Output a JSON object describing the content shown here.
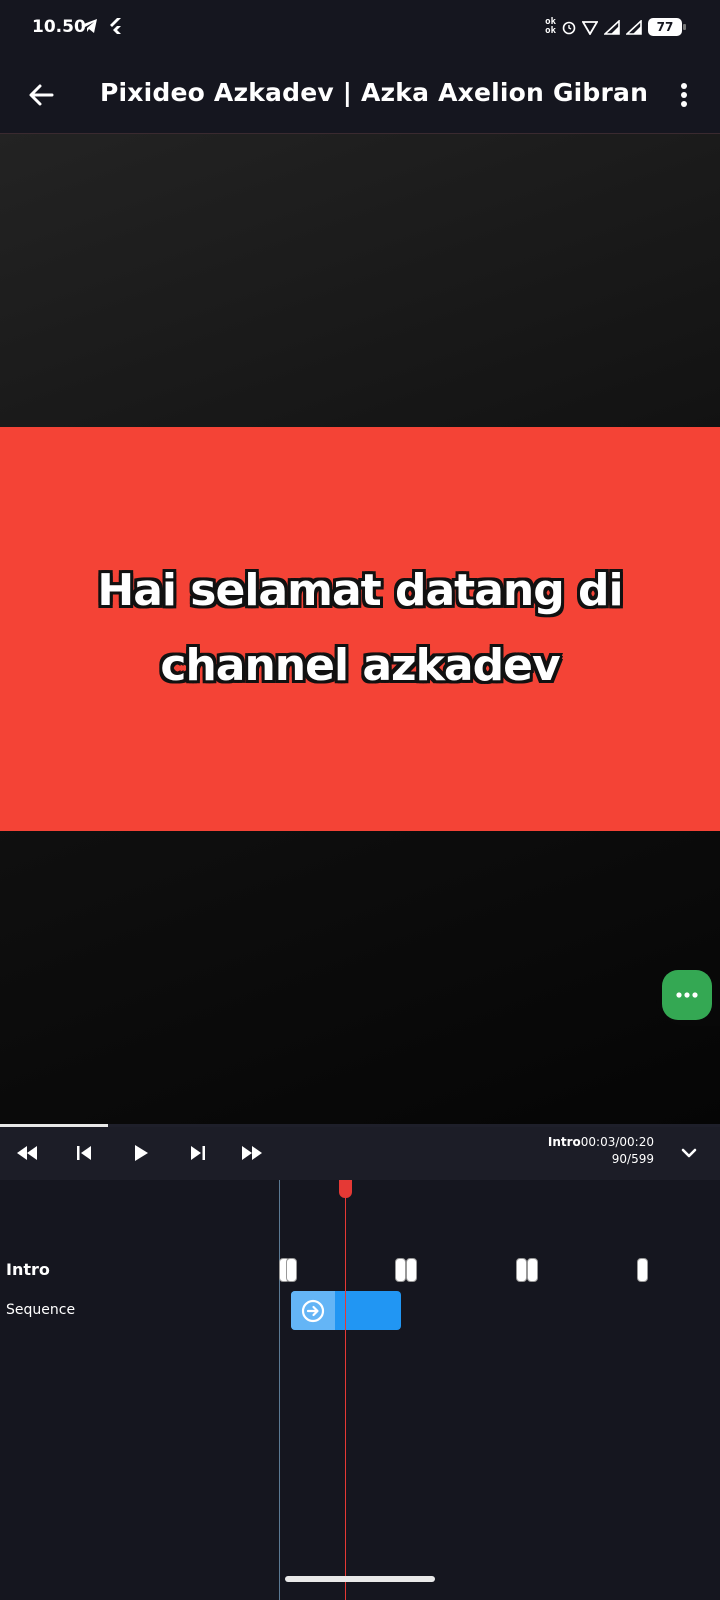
{
  "status_bar": {
    "time": "10.50",
    "battery": "77",
    "icons": [
      "telegram-icon",
      "flutter-icon",
      "ok-icon",
      "alarm-icon",
      "wifi-icon",
      "signal-icon",
      "signal-icon",
      "battery-icon"
    ]
  },
  "app_bar": {
    "title": "Pixideo Azkadev | Azka Axelion Gibran",
    "back_icon": "arrow-left-icon",
    "menu_icon": "more-vert-icon"
  },
  "preview": {
    "caption": "Hai selamat datang di channel azkadev",
    "caption_bg_color": "#f44336",
    "fab_icon": "more-horiz-icon",
    "fab_color": "#34a853"
  },
  "playback": {
    "progress": 0.15,
    "controls": [
      "fast-rewind-icon",
      "skip-previous-icon",
      "play-icon",
      "skip-next-icon",
      "fast-forward-icon"
    ],
    "clip_name": "Intro",
    "time": "00:03/00:20",
    "frame": "90/599",
    "collapse_icon": "chevron-down-icon"
  },
  "timeline": {
    "tracks": [
      {
        "label": "Intro"
      },
      {
        "label": "Sequence"
      }
    ],
    "clip_color": "#2196f3",
    "clip_icon": "arrow-circle-right-icon"
  }
}
